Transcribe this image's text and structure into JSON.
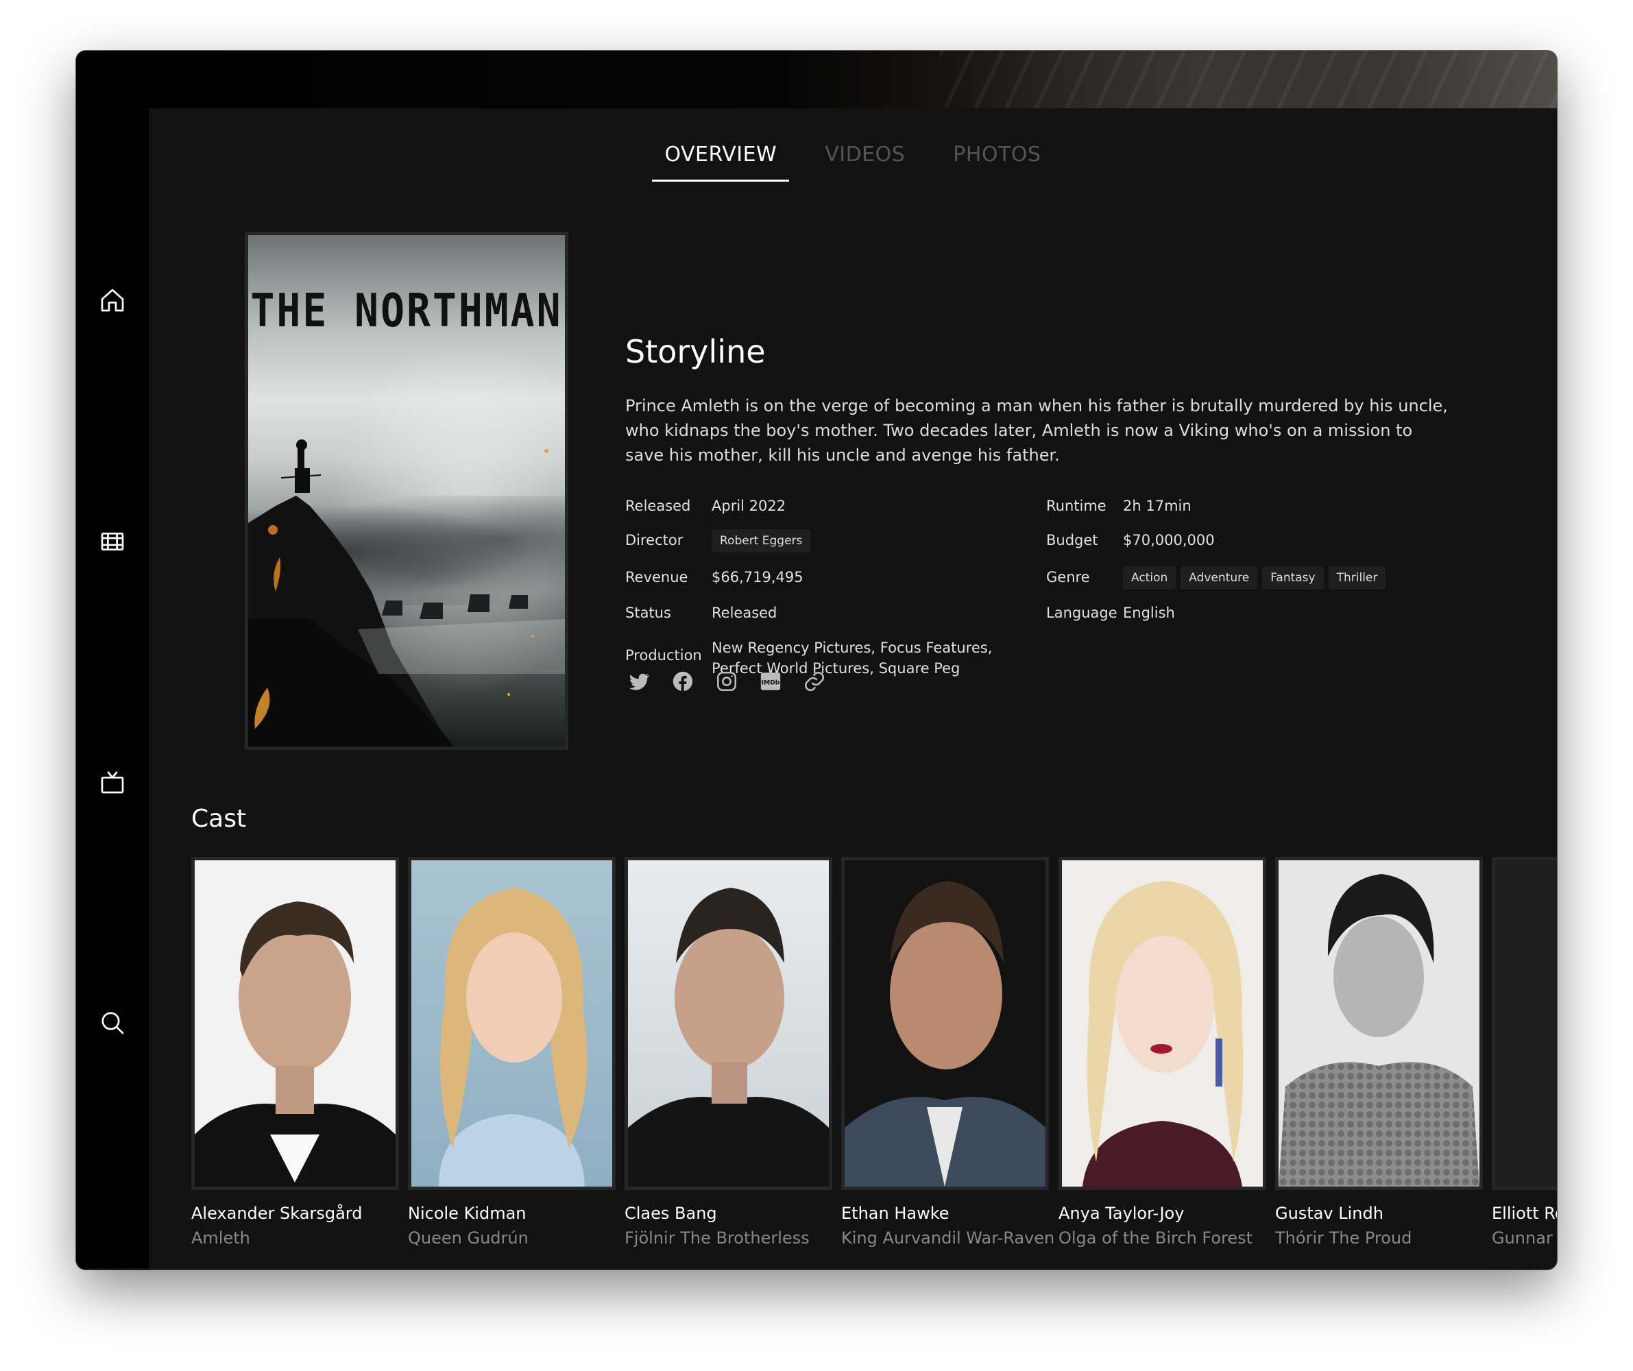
{
  "tabs": [
    {
      "label": "OVERVIEW",
      "active": true
    },
    {
      "label": "VIDEOS",
      "active": false
    },
    {
      "label": "PHOTOS",
      "active": false
    }
  ],
  "sidebar": {
    "items": [
      {
        "icon": "home-icon"
      },
      {
        "icon": "film-icon"
      },
      {
        "icon": "tv-icon"
      },
      {
        "icon": "search-icon"
      }
    ]
  },
  "poster": {
    "title": "THE NORTHMAN"
  },
  "storyline": {
    "title": "Storyline",
    "text": "Prince Amleth is on the verge of becoming a man when his father is brutally murdered by his uncle, who kidnaps the boy's mother. Two decades later, Amleth is now a Viking who's on a mission to save his mother, kill his uncle and avenge his father."
  },
  "details": {
    "released_label": "Released",
    "released_value": "April 2022",
    "director_label": "Director",
    "director_value": "Robert Eggers",
    "revenue_label": "Revenue",
    "revenue_value": "$66,719,495",
    "status_label": "Status",
    "status_value": "Released",
    "production_label": "Production",
    "production_value": "New Regency Pictures, Focus Features, Perfect World Pictures, Square Peg",
    "runtime_label": "Runtime",
    "runtime_value": "2h 17min",
    "budget_label": "Budget",
    "budget_value": "$70,000,000",
    "genre_label": "Genre",
    "genres": [
      "Action",
      "Adventure",
      "Fantasy",
      "Thriller"
    ],
    "language_label": "Language",
    "language_value": "English"
  },
  "social": [
    "twitter-icon",
    "facebook-icon",
    "instagram-icon",
    "imdb-icon",
    "link-icon"
  ],
  "imdb_label": "IMDb",
  "cast": {
    "title": "Cast",
    "members": [
      {
        "name": "Alexander Skarsgård",
        "role": "Amleth"
      },
      {
        "name": "Nicole Kidman",
        "role": "Queen Gudrún"
      },
      {
        "name": "Claes Bang",
        "role": "Fjölnir The Brotherless"
      },
      {
        "name": "Ethan Hawke",
        "role": "King Aurvandil War-Raven"
      },
      {
        "name": "Anya Taylor-Joy",
        "role": "Olga of the Birch Forest"
      },
      {
        "name": "Gustav Lindh",
        "role": "Thórir The Proud"
      },
      {
        "name": "Elliott Ro",
        "role": "Gunnar"
      }
    ]
  }
}
